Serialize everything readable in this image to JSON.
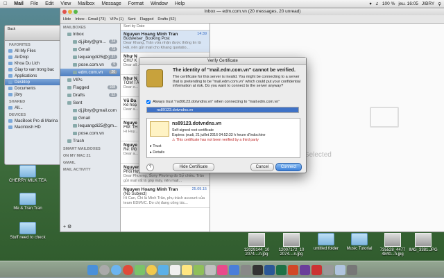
{
  "menubar": {
    "apple": "",
    "app": "Mail",
    "menus": [
      "File",
      "Edit",
      "View",
      "Mailbox",
      "Message",
      "Format",
      "Window",
      "Help"
    ],
    "battery": "100 %",
    "clock": "jeu. 16:05",
    "user": "JIBRY"
  },
  "desktop_icons": [
    {
      "label": "CHERRY MILK TEA"
    },
    {
      "label": "Me & Tran Tran"
    },
    {
      "label": "Stuff need to check"
    },
    {
      "label": "12029144_10 2074....n.jpg"
    },
    {
      "label": "12007172_10 2074....n.jpg"
    },
    {
      "label": "untitled folder"
    },
    {
      "label": "Music Tutorial"
    },
    {
      "label": "735528_4477 4840...n.jpg"
    },
    {
      "label": "IMG_3381.JPG"
    }
  ],
  "finder": {
    "back": "Back",
    "favorites_header": "FAVORITES",
    "favorites": [
      "All My Files",
      "AirDrop",
      "Khoa Du Lich",
      "Giay to van trong bac",
      "Applications",
      "Desktop",
      "Documents",
      "jibry"
    ],
    "shared_header": "SHARED",
    "shared": [
      "All..."
    ],
    "devices_header": "DEVICES",
    "devices": [
      "MacBook Pro di Marina",
      "Macintosh HD"
    ]
  },
  "mail": {
    "window_title": "Inbox — edm.com.vn (20 messages, 20 unread)",
    "favbar": [
      "Hide",
      "Inbox - Gmail (73)",
      "VIPs (1)",
      "Sent",
      "Flagged",
      "Drafts (52)"
    ],
    "mailboxes_header": "MAILBOXES",
    "inbox": "Inbox",
    "accounts": [
      {
        "name": "dj.jibry@gm...",
        "count": "24"
      },
      {
        "name": "Gmail",
        "count": "73"
      },
      {
        "name": "lequangdi25@gm...",
        "count": "37"
      },
      {
        "name": "pose.com.vn",
        "count": "9"
      },
      {
        "name": "edm.com.vn",
        "count": "20"
      }
    ],
    "vips": "VIPs",
    "flagged": "Flagged",
    "flagged_count": "108",
    "drafts": "Drafts",
    "drafts_count": "52",
    "sent": "Sent",
    "sent_accounts": [
      "dj.jibry@gmail.com",
      "Gmail",
      "lequangdi25@gm...",
      "pose.com.vn"
    ],
    "trash": "Trash",
    "smart_header": "SMART MAILBOXES",
    "on_my_mac": "ON MY MAC",
    "on_my_mac_count": "21",
    "gmail_header": "GMAIL",
    "activity_header": "MAIL ACTIVITY",
    "sort_label": "Sort by Date",
    "messages": [
      {
        "from": "Nguyen Hoang Minh Tran",
        "date": "14:39",
        "subject": "Budweiser_Booking Post",
        "preview": "Dear Khang, Trân vừa nhận được thông tin từ Hải, nên gửi mail cho Khang quotatio..."
      },
      {
        "from": "Như N",
        "date": "",
        "subject": "CHỮ K",
        "preview": "Dear all..."
      },
      {
        "from": "Như N",
        "date": "",
        "subject": "TÔM TẮ",
        "preview": "Dear e..."
      },
      {
        "from": "Vũ Đạ",
        "date": "",
        "subject": "Kế hoạ",
        "preview": "Dear a..."
      },
      {
        "from": "Nguye",
        "date": "",
        "subject": "FW: TH",
        "preview": "Hi Huy..."
      },
      {
        "from": "Nguye",
        "date": "",
        "subject": "Re: Mộ",
        "preview": "Dear a..."
      },
      {
        "from": "Nguyen Hoang Minh Tran",
        "date": "",
        "subject": "Phối Hợp Cùng EDM Community Cho C...",
        "preview": "Dear Phương, Sony Phường đo Sự chiều. Trân gửi mail rất là góp mày, nên mail..."
      },
      {
        "from": "Nguyen Hoang Minh Tran",
        "date": "25.09.15",
        "subject": "(No Subject)",
        "preview": "Hi Can, Chi là Minh Trân, phụ trách account của team EDMVC. Do chị đang công tác..."
      }
    ],
    "no_message": "No Message Selected"
  },
  "dialog": {
    "title": "Verify Certificate",
    "headline": "The identity of \"mail.edm.com.vn\" cannot be verified.",
    "body": "The certificate for this server is invalid. You might be connecting to a server that is pretending to be \"mail.edm.com.vn\" which could put your confidential information at risk. Do you want to connect to the server anyway?",
    "always_trust": "Always trust \"ns89123.dotvndns.vn\" when connecting to \"mail.edm.com.vn\"",
    "chain_item": "ns89123.dotvndns.vn",
    "cert_name": "ns89123.dotvndns.vn",
    "cert_type": "Self-signed root certificate",
    "cert_expires": "Expires: jeudi, 21 juillet 2016 04:52:33 h heure d'Indochine",
    "cert_warning": "This certificate has not been verified by a third party",
    "trust_label": "Trust",
    "details_label": "Details",
    "hide_cert": "Hide Certificate",
    "cancel": "Cancel",
    "connect": "Connect",
    "help": "?"
  }
}
